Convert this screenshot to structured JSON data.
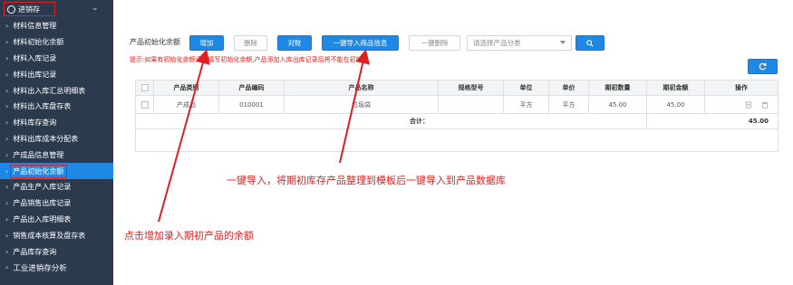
{
  "sidebar": {
    "header_label": "进销存",
    "items": [
      "材料信息管理",
      "材料初始化余额",
      "材料入库记录",
      "材料出库记录",
      "材料出入库汇总明细表",
      "材料出入库盘存表",
      "材料库存查询",
      "材料出库成本分配表",
      "产成品信息管理",
      "产品初始化余额",
      "产品生产入库记录",
      "产品销售出库记录",
      "产品出入库明细表",
      "销售成本核算及盘存表",
      "产品库存查询",
      "工业进销存分析"
    ],
    "active_index": 9
  },
  "toolbar": {
    "label": "产品初始化余额",
    "add": "增加",
    "delete": "删除",
    "reconcile": "对账",
    "import": "一键导入商品信息",
    "delete_all": "一键删除",
    "category_placeholder": "请选择产品分类"
  },
  "hint": "提示:如果有初始化余额请先填写初始化余额,产品添加入库出库记录后将不能在初始化",
  "table": {
    "headers": [
      "",
      "产品类别",
      "产品编码",
      "产品名称",
      "规格型号",
      "单位",
      "单价",
      "期初数量",
      "期初金额",
      "操作"
    ],
    "rows": [
      [
        "",
        "产成品",
        "010001",
        "垃圾袋",
        "",
        "平方",
        "平方",
        "45.00",
        "45.00",
        ""
      ]
    ],
    "total_label": "合计：",
    "total_value": "45.00"
  },
  "annotations": {
    "import_note": "一键导入，将期初库存产品整理到模板后一键导入到产品数据库",
    "add_note": "点击增加录入期初产品的余额"
  },
  "colors": {
    "sidebar_bg": "#2b3a4d",
    "primary": "#1e88e5",
    "annotation": "#e02020"
  }
}
